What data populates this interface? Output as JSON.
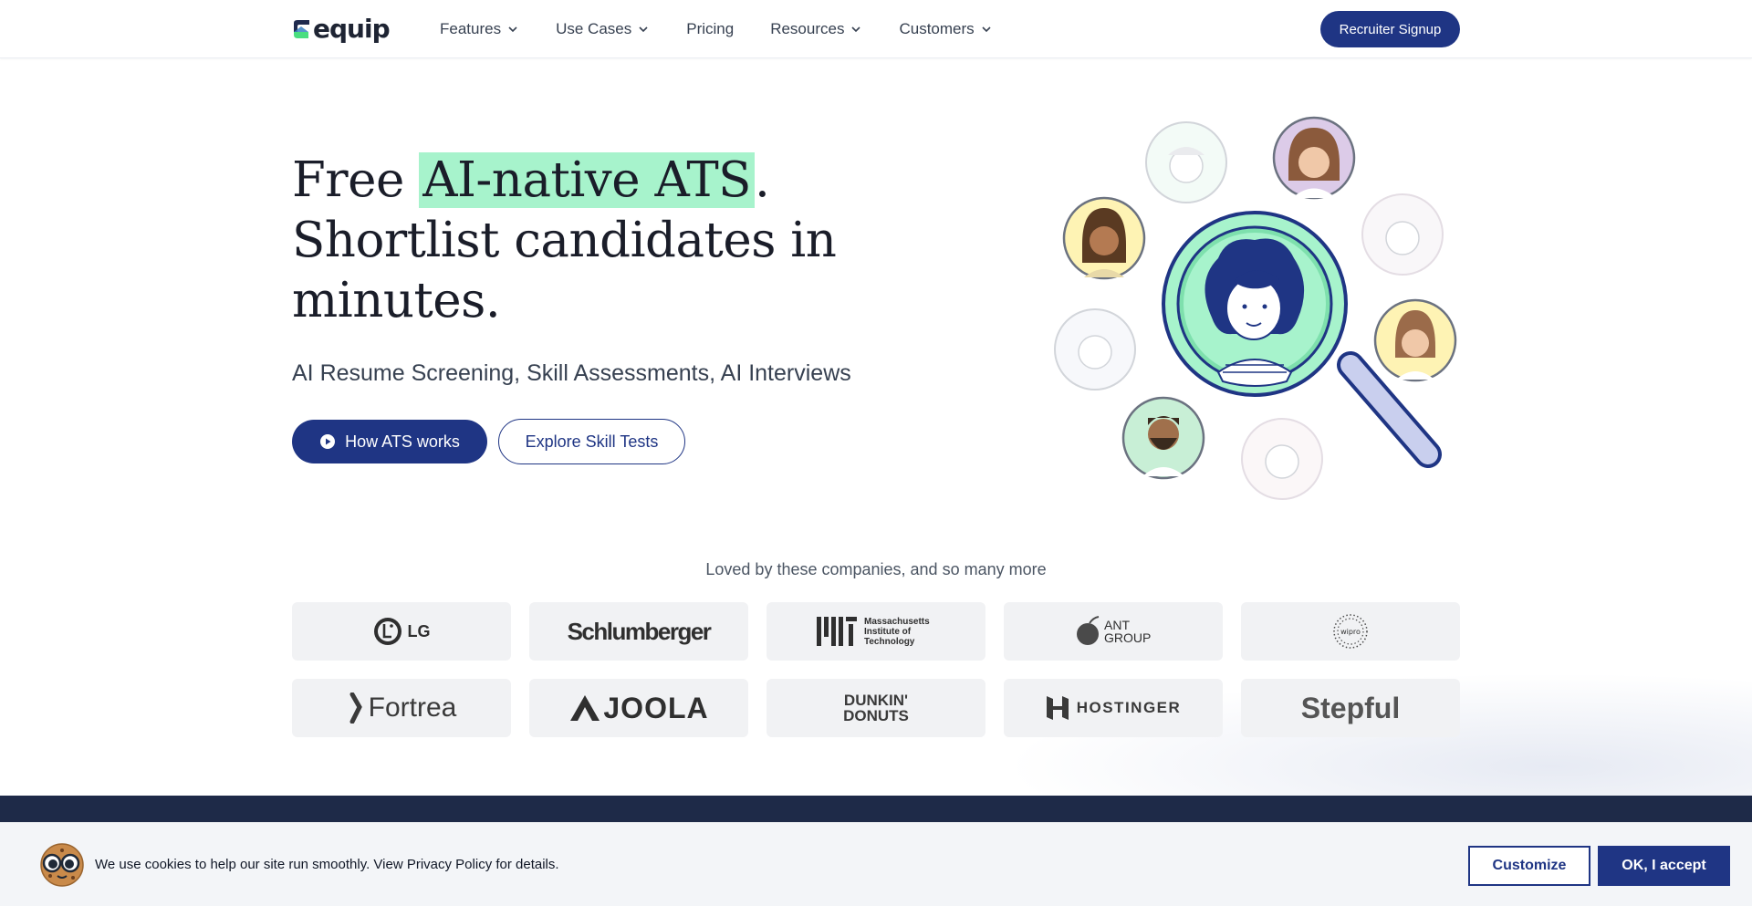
{
  "brand": {
    "name": "equip",
    "accent": "#1f3584",
    "highlight": "#a7f3cc"
  },
  "nav": {
    "items": [
      {
        "label": "Features",
        "has_dropdown": true
      },
      {
        "label": "Use Cases",
        "has_dropdown": true
      },
      {
        "label": "Pricing",
        "has_dropdown": false
      },
      {
        "label": "Resources",
        "has_dropdown": true
      },
      {
        "label": "Customers",
        "has_dropdown": true
      }
    ],
    "cta_label": "Recruiter Signup"
  },
  "hero": {
    "title_prefix": "Free ",
    "title_highlight": "AI-native ATS",
    "title_suffix": ".",
    "title_line2": "Shortlist candidates in",
    "title_line3": "minutes.",
    "subtitle": "AI Resume Screening, Skill Assessments, AI Interviews",
    "primary_button": "How ATS works",
    "secondary_button": "Explore Skill Tests"
  },
  "companies": {
    "heading": "Loved by these companies, and so many more",
    "logos": [
      {
        "name": "LG",
        "text": "LG"
      },
      {
        "name": "Schlumberger",
        "text": "Schlumberger"
      },
      {
        "name": "MIT",
        "text": "Massachusetts Institute of Technology"
      },
      {
        "name": "Ant Group",
        "text": "ANT GROUP"
      },
      {
        "name": "Wipro",
        "text": "wipro"
      },
      {
        "name": "Fortrea",
        "text": "Fortrea"
      },
      {
        "name": "Joola",
        "text": "JOOLA"
      },
      {
        "name": "Dunkin Donuts",
        "text": "DUNKIN' DONUTS"
      },
      {
        "name": "Hostinger",
        "text": "HOSTINGER"
      },
      {
        "name": "Stepful",
        "text": "Stepful"
      }
    ]
  },
  "cookie": {
    "message": "We use cookies to help our site run smoothly. View Privacy Policy for details.",
    "customize_label": "Customize",
    "accept_label": "OK, I accept"
  }
}
